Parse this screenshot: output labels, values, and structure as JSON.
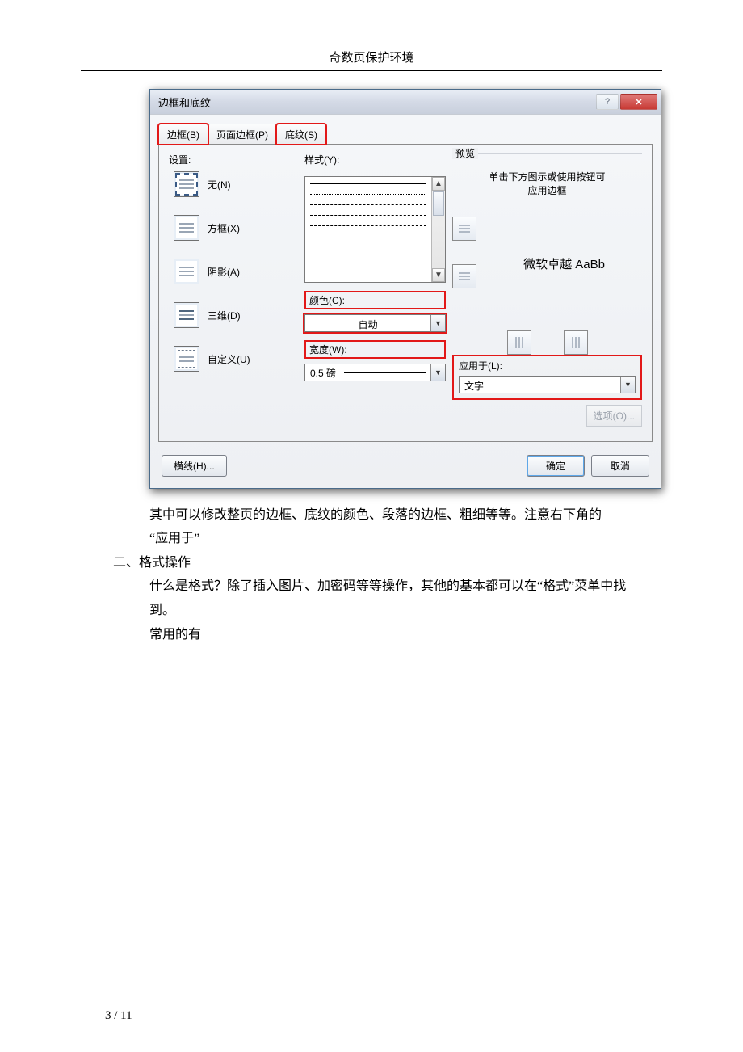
{
  "page_header": "奇数页保护环境",
  "dialog": {
    "title": "边框和底纹",
    "tabs": {
      "border": "边框(B)",
      "page_border": "页面边框(P)",
      "shading": "底纹(S)"
    },
    "settings_label": "设置:",
    "settings": {
      "none": "无(N)",
      "box": "方框(X)",
      "shadow": "阴影(A)",
      "threeD": "三维(D)",
      "custom": "自定义(U)"
    },
    "style_label": "样式(Y):",
    "color_label": "颜色(C):",
    "color_value": "自动",
    "width_label": "宽度(W):",
    "width_value": "0.5 磅",
    "preview_label": "预览",
    "preview_hint1": "单击下方图示或使用按钮可",
    "preview_hint2": "应用边框",
    "preview_sample": "微软卓越 AaBb",
    "apply_label": "应用于(L):",
    "apply_value": "文字",
    "options_btn": "选项(O)...",
    "hline_btn": "横线(H)...",
    "ok": "确定",
    "cancel": "取消"
  },
  "body_text": {
    "l1": "其中可以修改整页的边框、底纹的颜色、段落的边框、粗细等等。注意右下角的",
    "l2": "“应用于”",
    "h2": "二、格式操作",
    "l3": "什么是格式？除了插入图片、加密码等等操作，其他的基本都可以在“格式”菜单中找",
    "l4": "到。",
    "l5": "常用的有"
  },
  "footer": "3 / 11"
}
